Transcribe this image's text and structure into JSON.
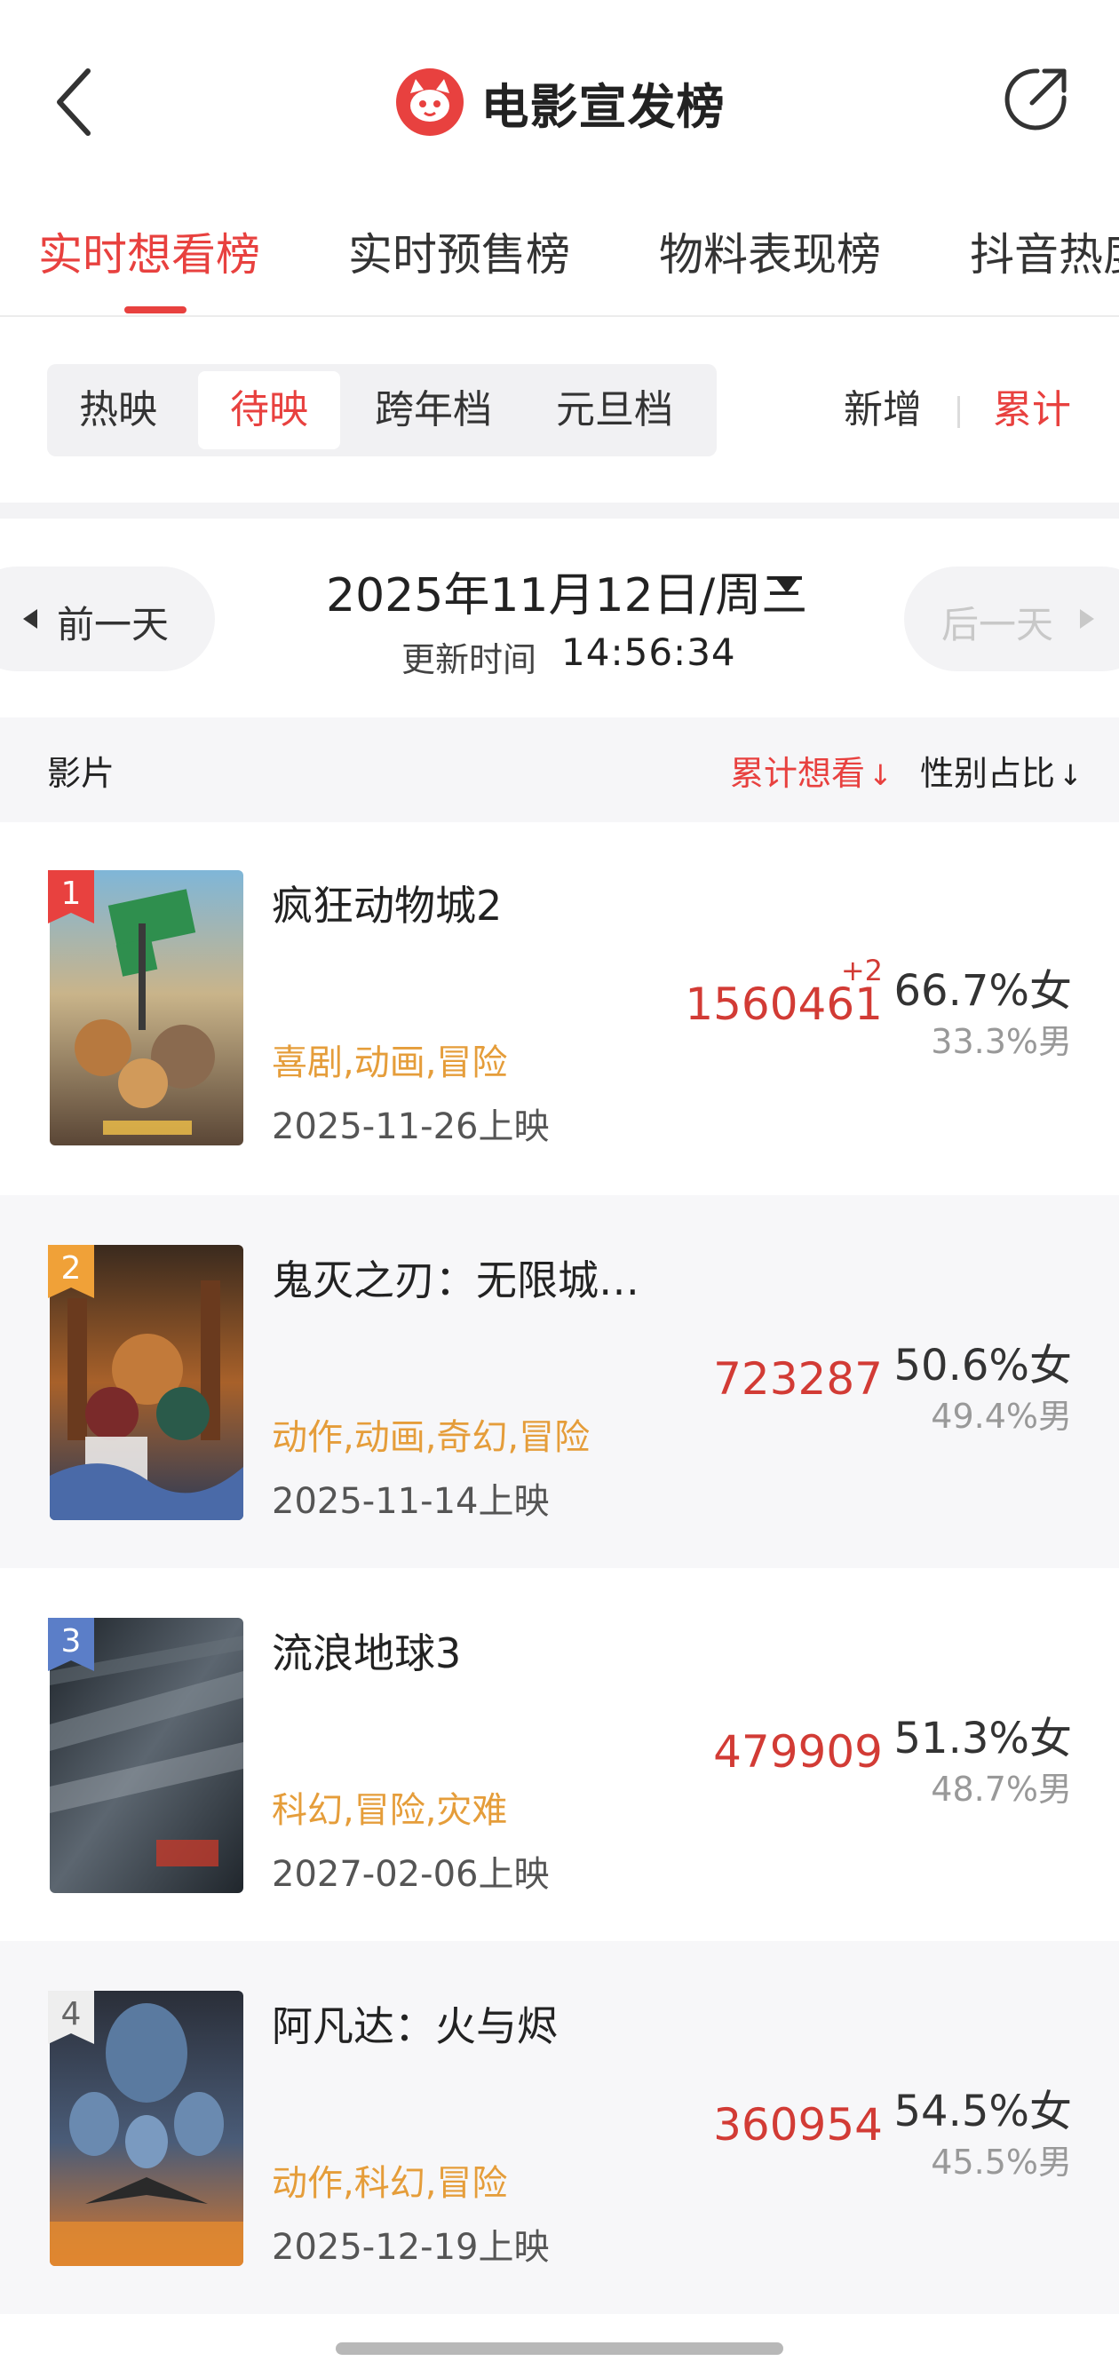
{
  "header": {
    "title": "电影宣发榜",
    "back_icon": "chevron-left-icon",
    "share_icon": "share-icon",
    "logo_icon": "cat-logo-icon",
    "brand_color": "#e8413f"
  },
  "main_tabs": [
    {
      "label": "实时想看榜",
      "active": true
    },
    {
      "label": "实时预售榜",
      "active": false
    },
    {
      "label": "物料表现榜",
      "active": false
    },
    {
      "label": "抖音热度榜",
      "active": false
    }
  ],
  "sub_filters": [
    {
      "label": "热映",
      "active": false
    },
    {
      "label": "待映",
      "active": true
    },
    {
      "label": "跨年档",
      "active": false
    },
    {
      "label": "元旦档",
      "active": false
    }
  ],
  "toggle": {
    "new_label": "新增",
    "total_label": "累计",
    "active": "total"
  },
  "date_nav": {
    "prev_label": "前一天",
    "next_label": "后一天",
    "date": "2025年11月12日/周三",
    "update_label": "更新时间",
    "update_time": "14:56:34"
  },
  "columns": {
    "film": "影片",
    "want": "累计想看",
    "gender": "性别占比"
  },
  "movies": [
    {
      "rank": "1",
      "title": "疯狂动物城2",
      "genre": "喜剧,动画,冒险",
      "release": "2025-11-26上映",
      "want": "1560461",
      "want_delta": "+2",
      "female": "66.7%女",
      "male": "33.3%男",
      "rank_color": "#e8413f"
    },
    {
      "rank": "2",
      "title": "鬼灭之刃：无限城…",
      "genre": "动作,动画,奇幻,冒险",
      "release": "2025-11-14上映",
      "want": "723287",
      "want_delta": "",
      "female": "50.6%女",
      "male": "49.4%男",
      "rank_color": "#f0a138"
    },
    {
      "rank": "3",
      "title": "流浪地球3",
      "genre": "科幻,冒险,灾难",
      "release": "2027-02-06上映",
      "want": "479909",
      "want_delta": "",
      "female": "51.3%女",
      "male": "48.7%男",
      "rank_color": "#5b7ec8"
    },
    {
      "rank": "4",
      "title": "阿凡达：火与烬",
      "genre": "动作,科幻,冒险",
      "release": "2025-12-19上映",
      "want": "360954",
      "want_delta": "",
      "female": "54.5%女",
      "male": "45.5%男",
      "rank_color": "#e8e8e8"
    }
  ]
}
